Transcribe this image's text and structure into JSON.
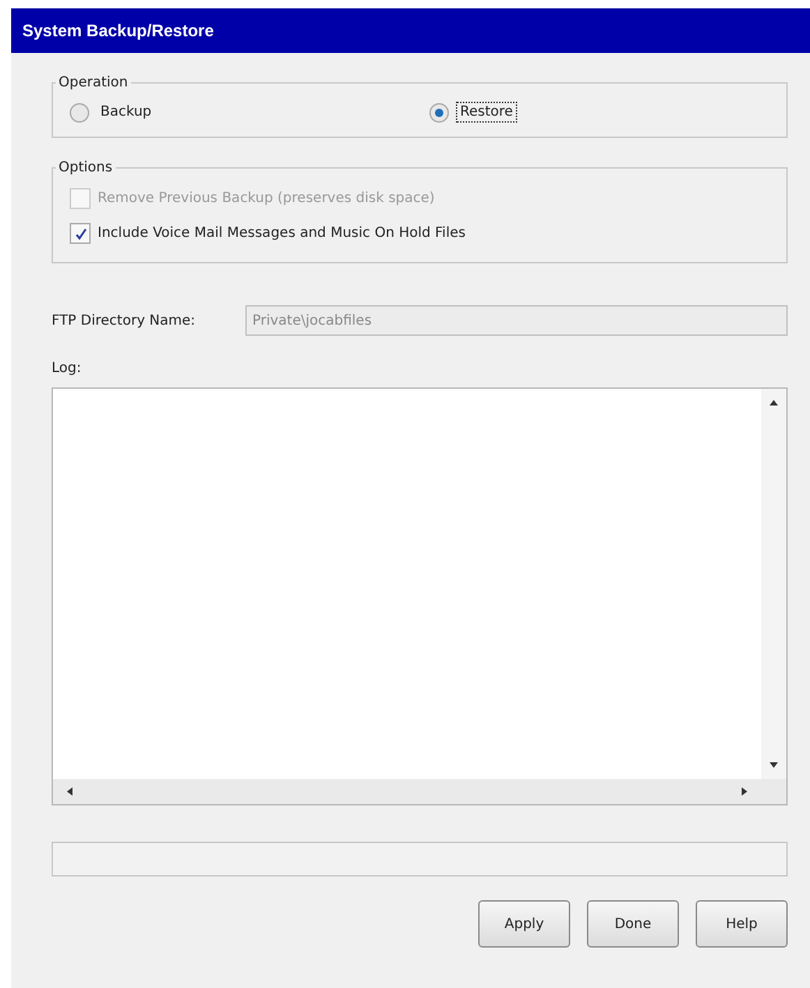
{
  "window": {
    "title": "System Backup/Restore"
  },
  "operation": {
    "legend": "Operation",
    "options": [
      {
        "label": "Backup",
        "selected": false
      },
      {
        "label": "Restore",
        "selected": true
      }
    ]
  },
  "options": {
    "legend": "Options",
    "items": [
      {
        "label": "Remove Previous Backup (preserves disk space)",
        "checked": false,
        "disabled": true
      },
      {
        "label": "Include Voice Mail Messages and Music On Hold Files",
        "checked": true,
        "disabled": false
      }
    ]
  },
  "ftp": {
    "label": "FTP Directory Name:",
    "value": "Private\\jocabfiles"
  },
  "log": {
    "label": "Log:"
  },
  "buttons": [
    "Apply",
    "Done",
    "Help"
  ]
}
